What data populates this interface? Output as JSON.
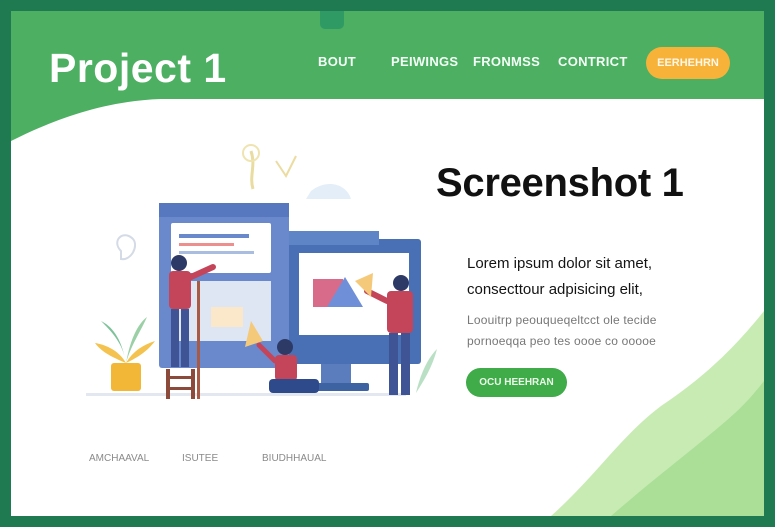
{
  "header": {
    "title": "Project 1",
    "nav": [
      "BOUT",
      "PEIWINGS",
      "FRONMSS",
      "CONTRICT"
    ],
    "cta": "EERHEHRN"
  },
  "hero": {
    "title": "Screenshot 1",
    "line1": "Lorem ipsum dolor sit amet,",
    "line2": "consecttour adpisicing elit,",
    "small1": "Loouitrp peouqueqeltcct ole tecide",
    "small2": "pornoeqqa peo tes oooe co ooooe",
    "button": "OCU HEEHRAN"
  },
  "footer": {
    "links": [
      "AMCHAAVAL",
      "ISUTEE",
      "BIUDHHAUAL"
    ]
  },
  "colors": {
    "header_green": "#4caf62",
    "frame_green": "#1f7a52",
    "cta_orange": "#f7b23a",
    "button_green": "#3fab49",
    "wave_light": "#c8ebb4"
  }
}
